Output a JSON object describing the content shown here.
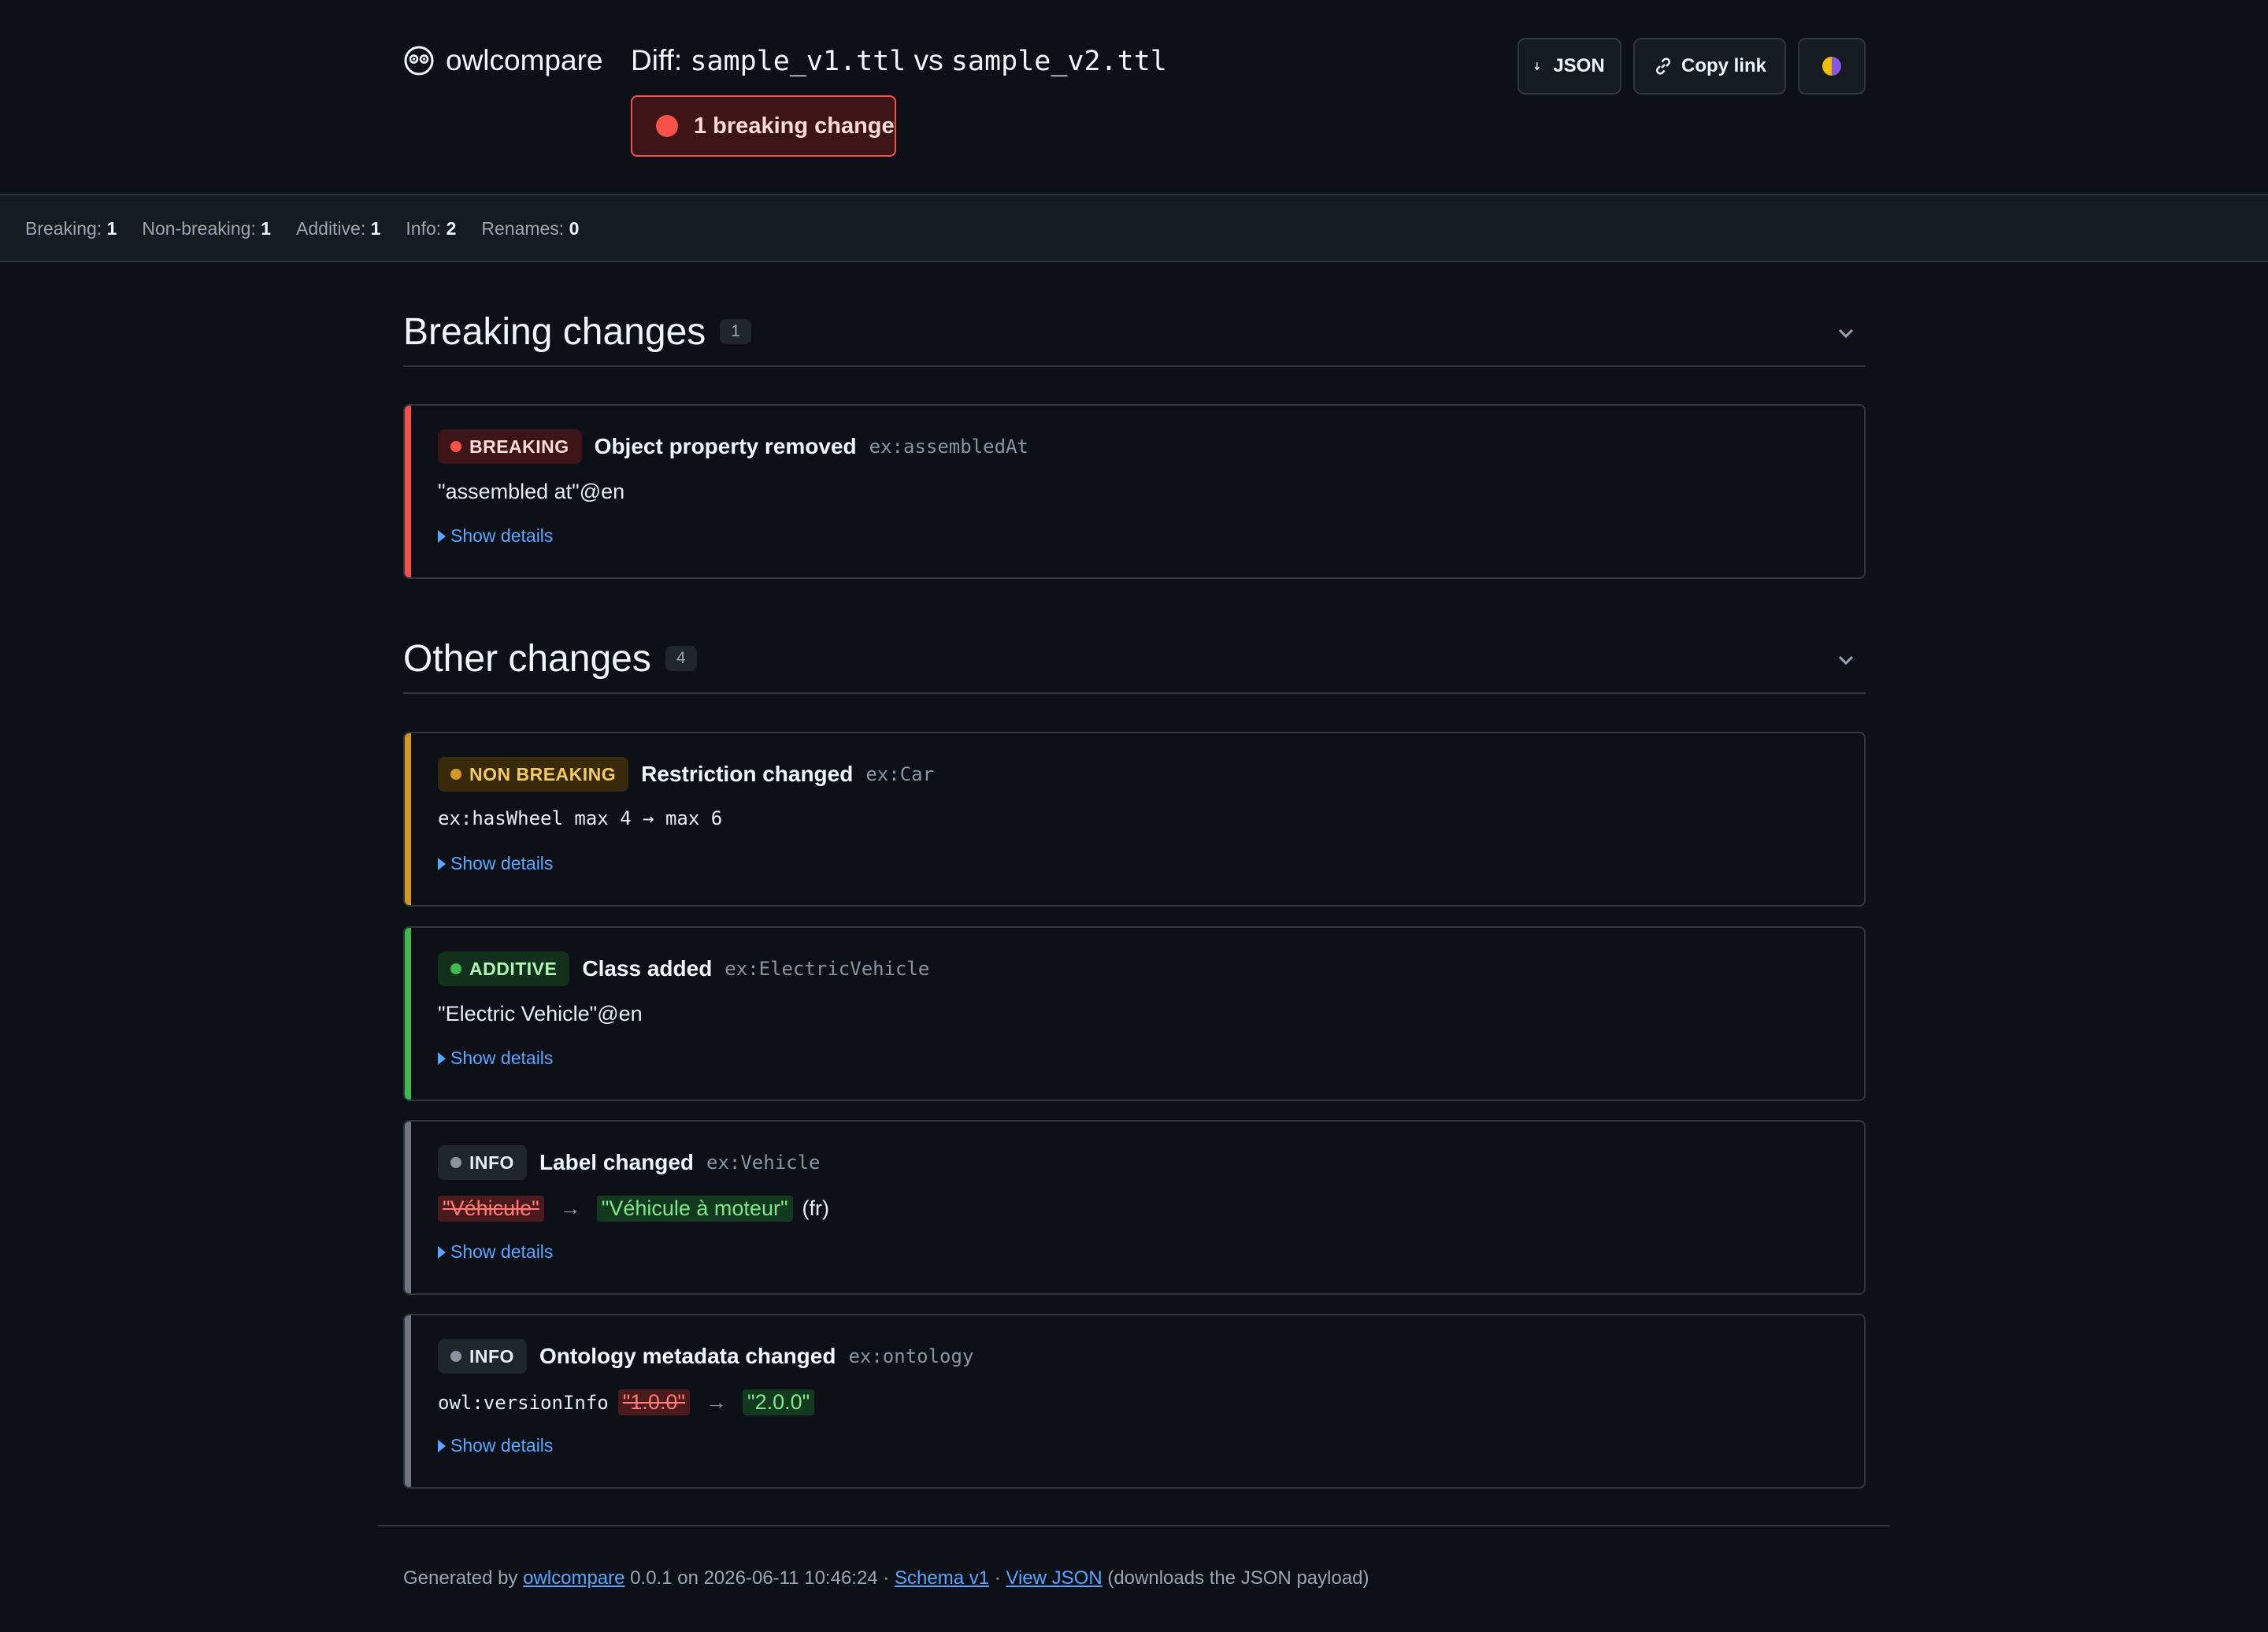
{
  "header": {
    "brand": "owlcompare",
    "title_prefix": "Diff:",
    "file_a": "sample_v1.ttl",
    "vs": "vs",
    "file_b": "sample_v2.ttl",
    "breaking_pill": "1 breaking change",
    "json_button": "JSON",
    "copy_link_button": "Copy link"
  },
  "stats": [
    {
      "label": "Breaking:",
      "value": "1"
    },
    {
      "label": "Non-breaking:",
      "value": "1"
    },
    {
      "label": "Additive:",
      "value": "1"
    },
    {
      "label": "Info:",
      "value": "2"
    },
    {
      "label": "Renames:",
      "value": "0"
    }
  ],
  "sections": {
    "breaking": {
      "title": "Breaking changes",
      "count": "1"
    },
    "other": {
      "title": "Other changes",
      "count": "4"
    }
  },
  "severity_colors": {
    "breaking": "#f85149",
    "non_breaking": "#d29922",
    "additive": "#3fb950",
    "info": "#8b949e"
  },
  "cards": [
    {
      "severity": "BREAKING",
      "title": "Object property removed",
      "id": "ex:assembledAt",
      "detail": "\"assembled at\"@en",
      "show_details": "Show details"
    },
    {
      "severity": "NON BREAKING",
      "title": "Restriction changed",
      "id": "ex:Car",
      "detail": "ex:hasWheel max 4 → max 6",
      "show_details": "Show details"
    },
    {
      "severity": "ADDITIVE",
      "title": "Class added",
      "id": "ex:ElectricVehicle",
      "detail": "\"Electric Vehicle\"@en",
      "show_details": "Show details"
    },
    {
      "severity": "INFO",
      "title": "Label changed",
      "id": "ex:Vehicle",
      "old": "\"Véhicule\"",
      "arrow": "→",
      "new": "\"Véhicule à moteur\"",
      "suffix": "(fr)",
      "show_details": "Show details"
    },
    {
      "severity": "INFO",
      "title": "Ontology metadata changed",
      "id": "ex:ontology",
      "prop": "owl:versionInfo",
      "old": "\"1.0.0\"",
      "arrow": "→",
      "new": "\"2.0.0\"",
      "show_details": "Show details"
    }
  ],
  "footer": {
    "generated_by": "Generated by",
    "tool_link": "owlcompare",
    "version_date": "0.0.1 on 2026-06-11 10:46:24 ·",
    "schema_link": "Schema v1",
    "sep": "·",
    "json_link": "View JSON",
    "json_note": "(downloads the JSON payload)"
  }
}
